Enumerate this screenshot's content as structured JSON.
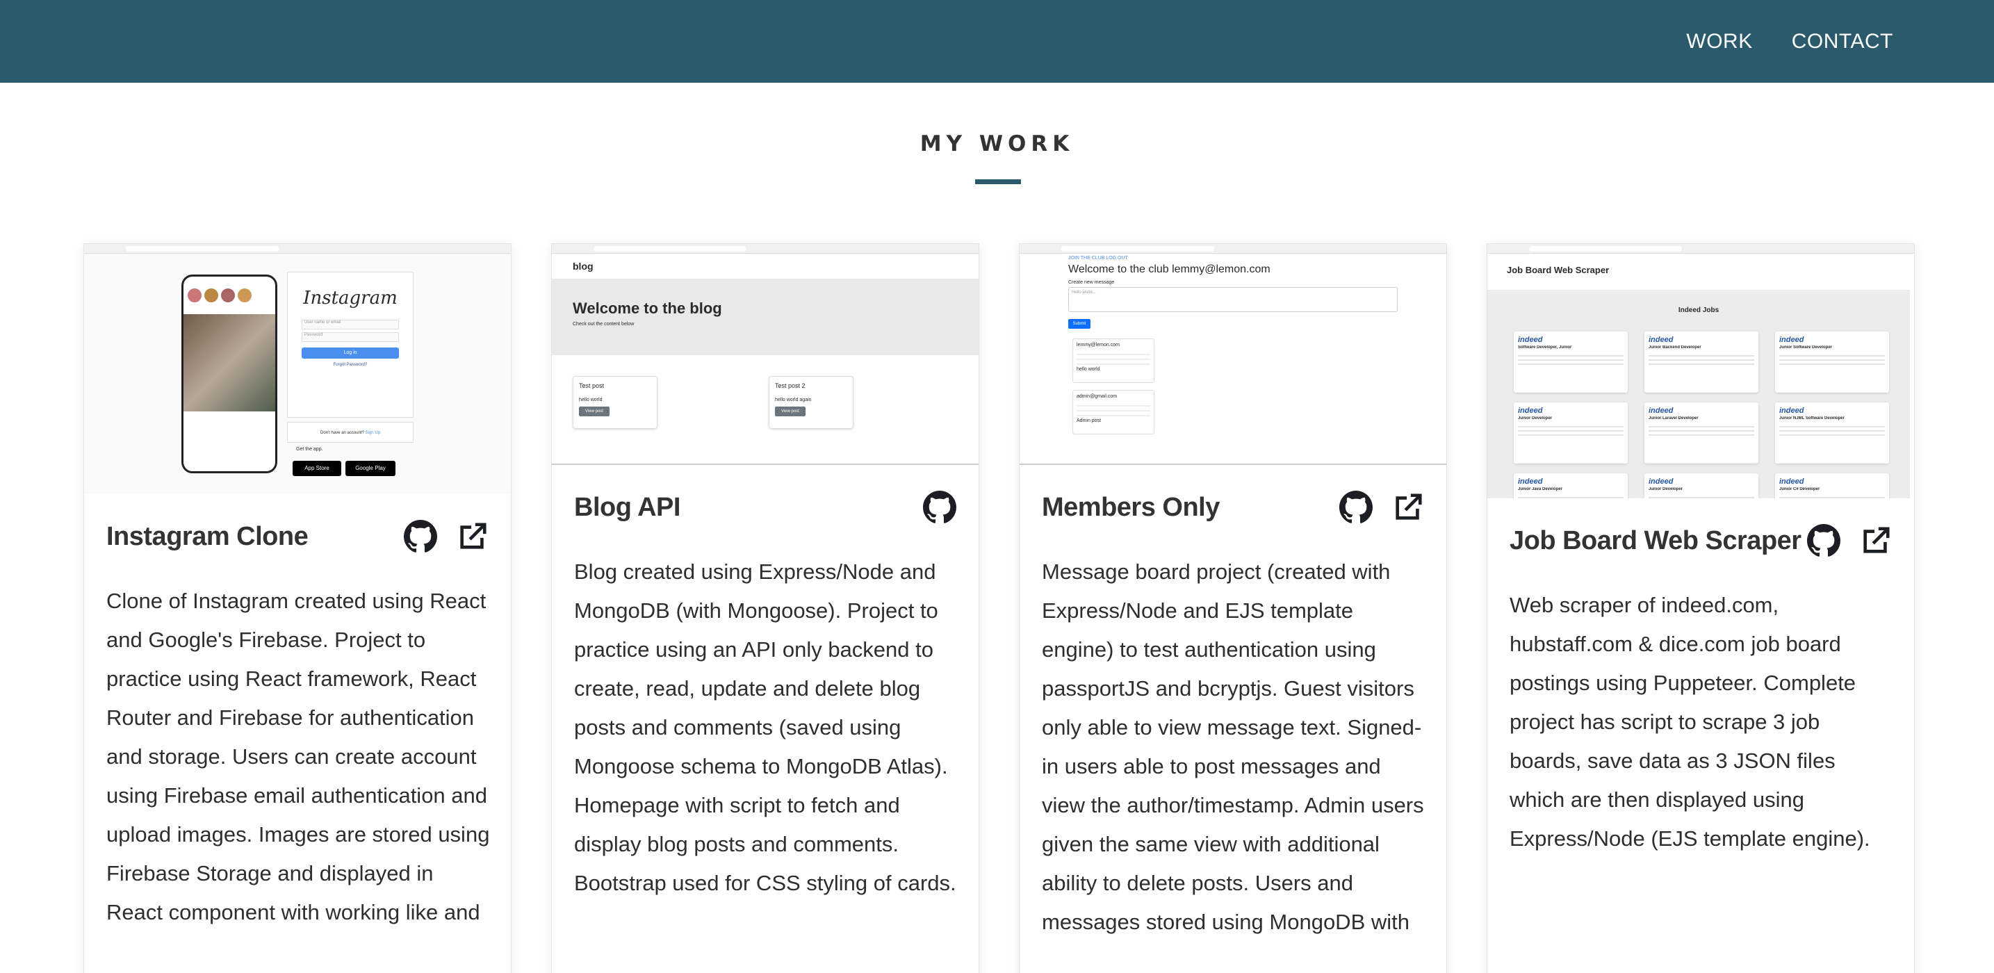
{
  "nav": {
    "work": "WORK",
    "contact": "CONTACT"
  },
  "section": {
    "title": "MY WORK"
  },
  "colors": {
    "primary": "#2a5a6b"
  },
  "projects": [
    {
      "title": "Instagram Clone",
      "description": "Clone of Instagram created using React and Google's Firebase. Project to practice using React framework, React Router and Firebase for authentication and storage. Users can create account using Firebase email authentication and upload images. Images are stored using Firebase Storage and displayed in React component with working like and",
      "icons": [
        "github-icon",
        "external-link-icon"
      ],
      "thumb": {
        "brand": "Instagram",
        "email_placeholder": "User name or email",
        "password_placeholder": "Password",
        "login": "Log in",
        "forgot": "Forgot Password?",
        "signup_prompt": "Don't have an account?",
        "signup_link": "Sign Up",
        "get_app": "Get the app.",
        "app_store": "App Store",
        "google_play": "Google Play"
      }
    },
    {
      "title": "Blog API",
      "description": "Blog created using Express/Node and MongoDB (with Mongoose). Project to practice using an API only backend to create, read, update and delete blog posts and comments (saved using Mongoose schema to MongoDB Atlas). Homepage with script to fetch and display blog posts and comments. Bootstrap used for CSS styling of cards.",
      "icons": [
        "github-icon"
      ],
      "thumb": {
        "brand": "blog",
        "hero": "Welcome to the blog",
        "hero_sub": "Check out the content below",
        "post1": "Test post",
        "post1_body": "hello world",
        "post2": "Test post 2",
        "post2_body": "hello world again",
        "view": "View post"
      }
    },
    {
      "title": "Members Only",
      "description": "Message board project (created with Express/Node and EJS template engine) to test authentication using passportJS and bcryptjs. Guest visitors only able to view message text. Signed-in users able to post messages and view the author/timestamp. Admin users given the same view with additional ability to delete posts. Users and messages stored using MongoDB with",
      "icons": [
        "github-icon",
        "external-link-icon"
      ],
      "thumb": {
        "links": "JOIN THE CLUB  LOG OUT",
        "heading": "Welcome to the club lemmy@lemon.com",
        "create": "Create new message",
        "placeholder": "Hello world...",
        "submit": "Submit",
        "msg1_author": "lemmy@lemon.com",
        "msg1_body": "hello world",
        "msg2_author": "admin@gmail.com",
        "msg2_body": "Admin post"
      }
    },
    {
      "title": "Job Board Web Scraper",
      "description": "Web scraper of indeed.com, hubstaff.com & dice.com job board postings using Puppeteer. Complete project has script to scrape 3 job boards, save data as 3 JSON files which are then displayed using Express/Node (EJS template engine).",
      "icons": [
        "github-icon",
        "external-link-icon"
      ],
      "thumb": {
        "header": "Job Board Web Scraper",
        "subheader": "Indeed Jobs",
        "logo": "indeed",
        "jobs": [
          "Software Developer, Junior",
          "Junior Backend Developer",
          "Junior Software Developer",
          "Junior Developer",
          "Junior Laravel Developer",
          "Junior NJML Software Developer",
          "Junior Java Developer",
          "Junior Developer",
          "Junior C# Developer"
        ]
      }
    }
  ]
}
